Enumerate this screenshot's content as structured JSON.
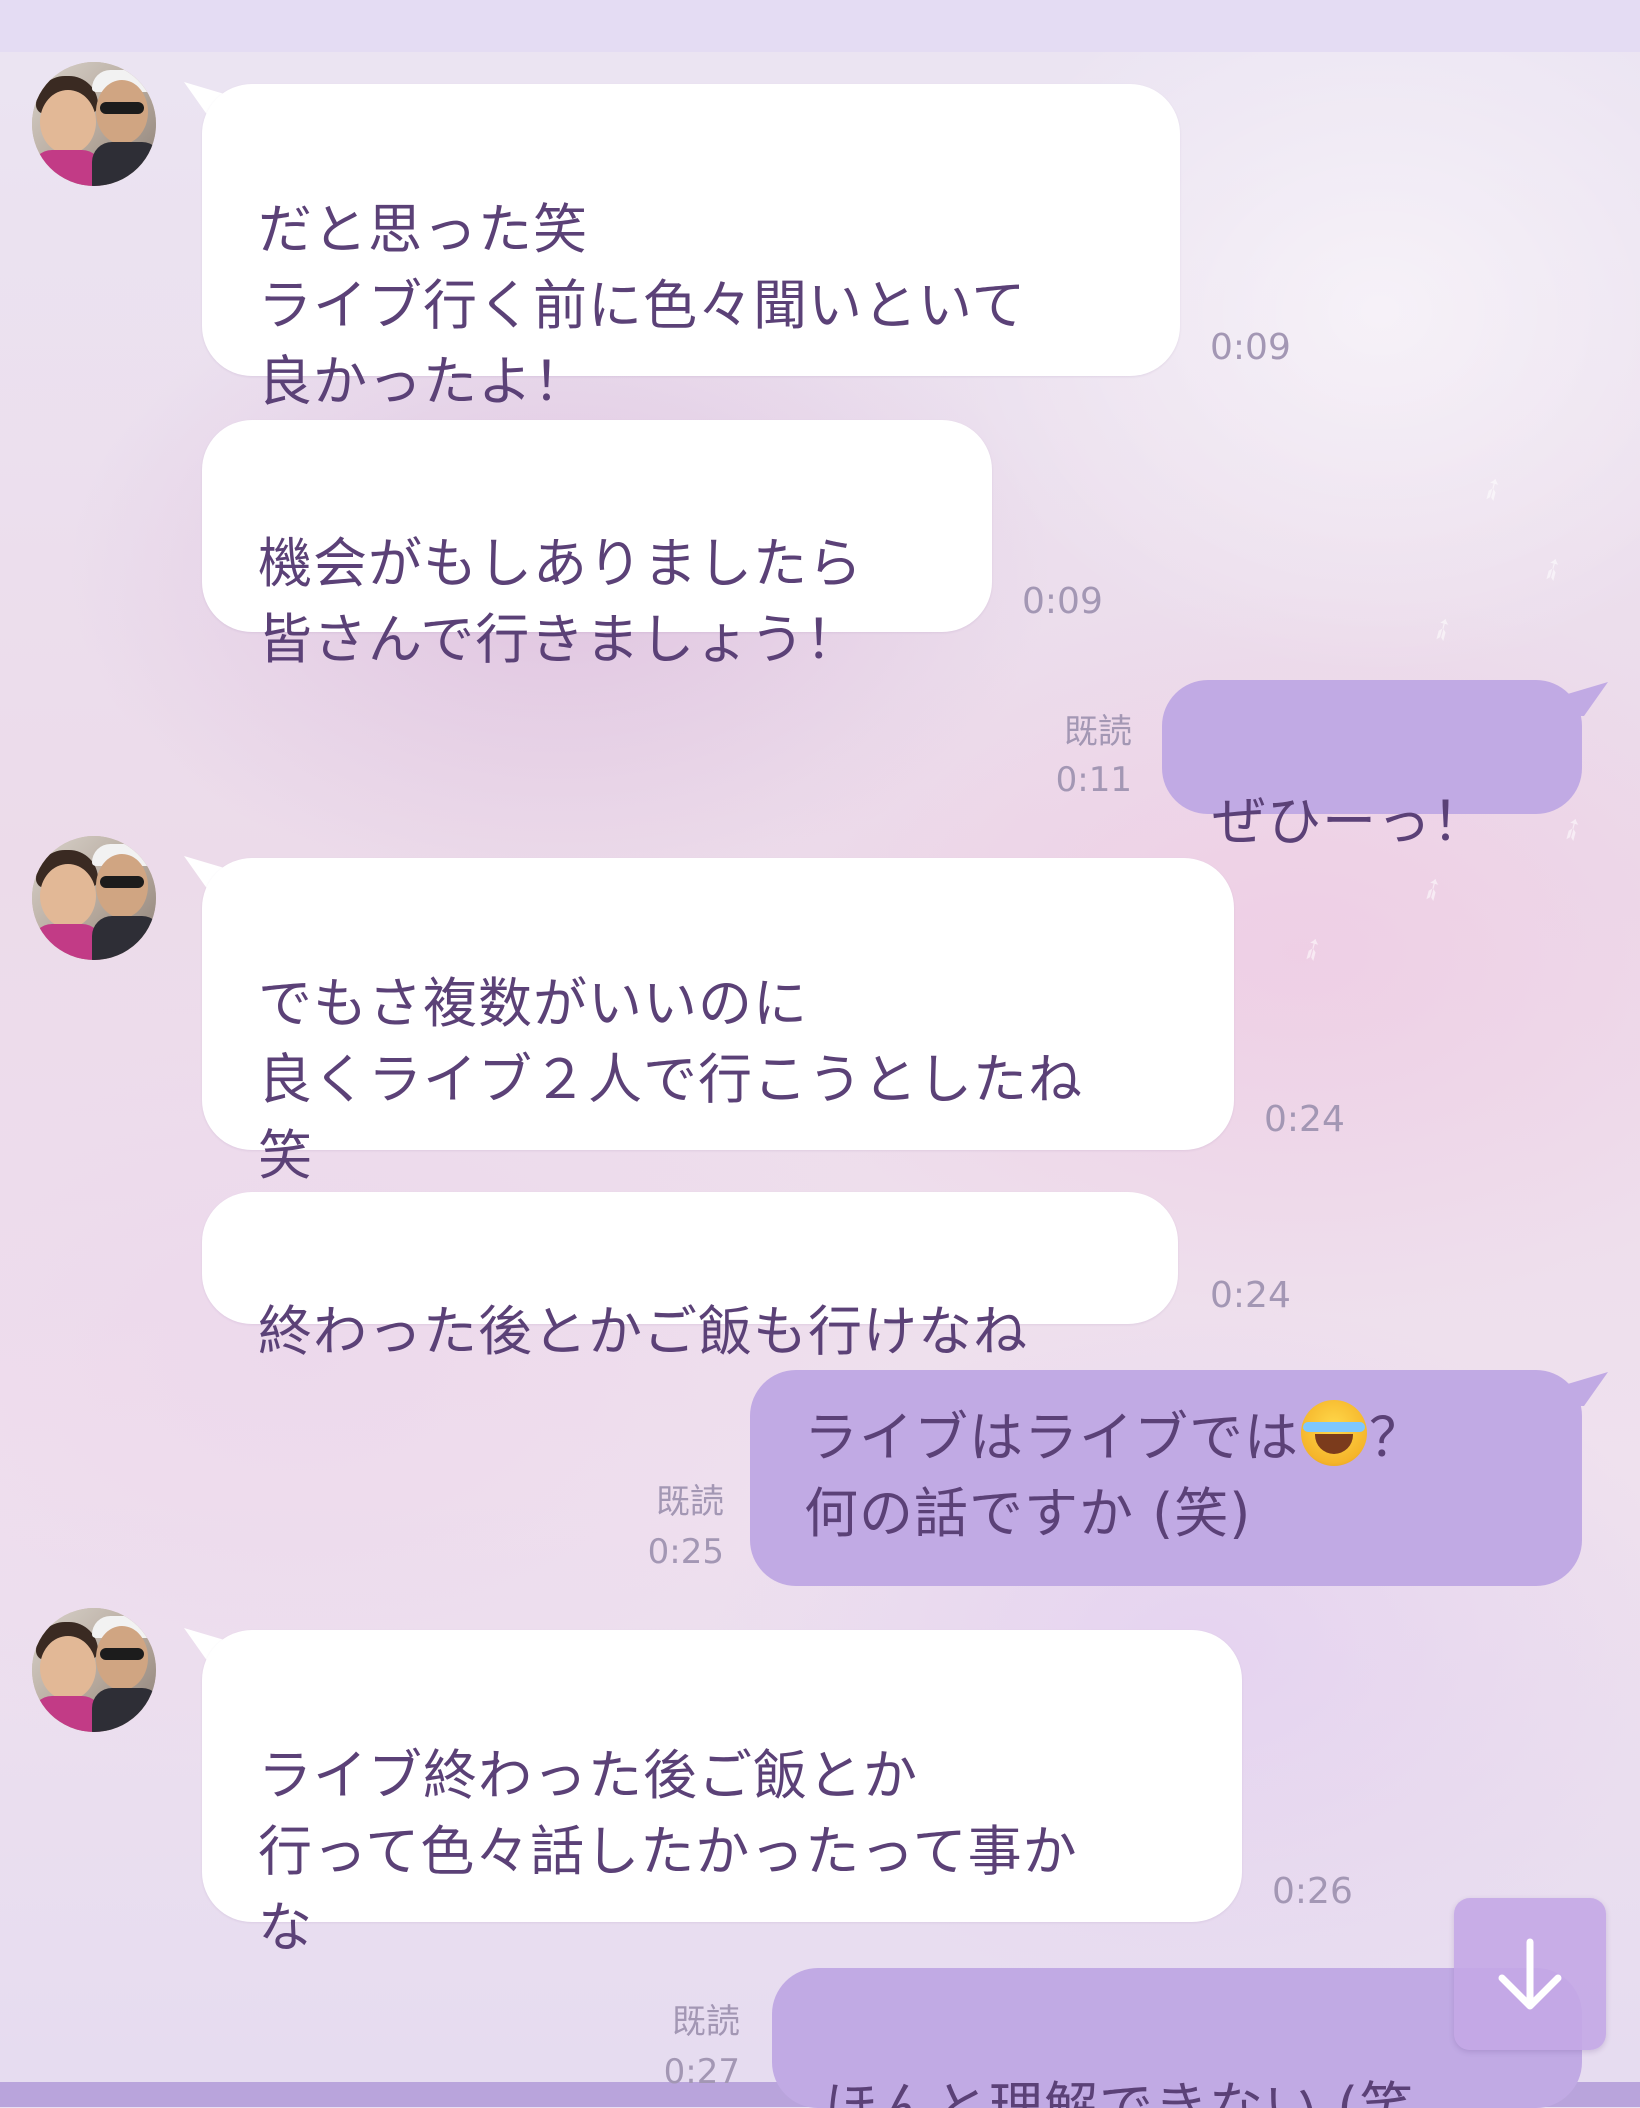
{
  "chat": {
    "messages": [
      {
        "direction": "incoming",
        "text": "だと思った笑\nライブ行く前に色々聞いといて\n良かったよ！",
        "time": "0:09"
      },
      {
        "direction": "incoming",
        "text": "機会がもしありましたら\n皆さんで行きましょう！",
        "time": "0:09"
      },
      {
        "direction": "outgoing",
        "text": "ぜひーっ！",
        "read": "既読",
        "time": "0:11"
      },
      {
        "direction": "incoming",
        "text": "でもさ複数がいいのに\n良くライブ２人で行こうとしたね\n笑",
        "time": "0:24"
      },
      {
        "direction": "incoming",
        "text": "終わった後とかご飯も行けなね",
        "time": "0:24"
      },
      {
        "direction": "outgoing",
        "text_before_emoji": "ライブはライブでは",
        "emoji": "face-with-tears-of-joy-emoji",
        "text_after_emoji": "？",
        "text_line2": "何の話ですか (笑)",
        "read": "既読",
        "time": "0:25"
      },
      {
        "direction": "incoming",
        "text": "ライブ終わった後ご飯とか\n行って色々話したかったって事か\nな",
        "time": "0:26"
      },
      {
        "direction": "outgoing",
        "text": "ほんと理解できない (笑",
        "read": "既読",
        "time": "0:27"
      }
    ]
  },
  "icons": {
    "avatar": "contact-avatar-photo",
    "scroll_down": "arrow-down-icon"
  },
  "colors": {
    "incoming_bubble": "#ffffff",
    "outgoing_bubble": "#c1aae4",
    "message_text": "#5b4177",
    "meta_text": "#a397b4"
  }
}
